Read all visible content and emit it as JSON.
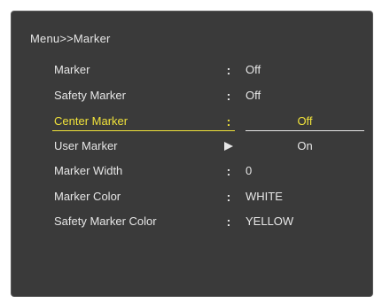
{
  "menu": {
    "breadcrumb": "Menu>>Marker",
    "items": [
      {
        "label": "Marker",
        "value": "Off"
      },
      {
        "label": "Safety Marker",
        "value": "Off"
      },
      {
        "label": "Center Marker",
        "value": "Off"
      },
      {
        "label": "User Marker",
        "value": "On"
      },
      {
        "label": "Marker Width",
        "value": "0"
      },
      {
        "label": "Marker Color",
        "value": "WHITE"
      },
      {
        "label": "Safety Marker Color",
        "value": "YELLOW"
      }
    ],
    "separator": ":"
  },
  "colors": {
    "background": "#3a3a3a",
    "text": "#e6e6e6",
    "highlight": "#f0e23a"
  },
  "icons": {
    "submenu_arrow": "triangle-right-icon"
  }
}
